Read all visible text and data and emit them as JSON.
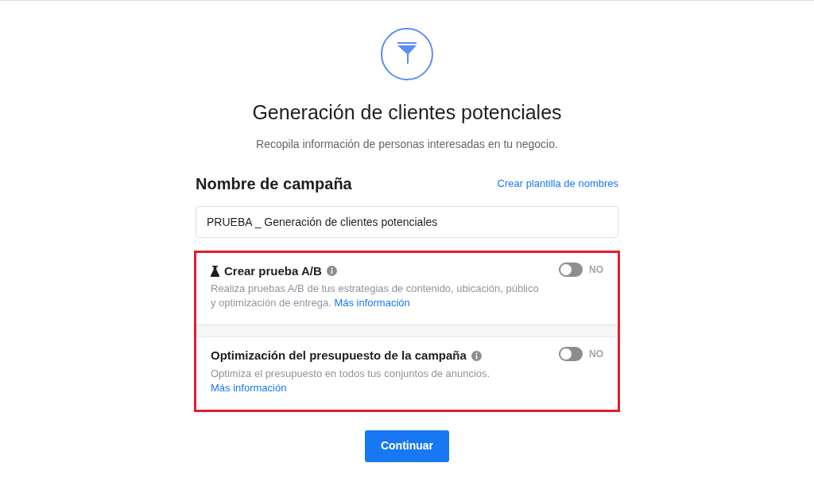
{
  "header": {
    "title": "Generación de clientes potenciales",
    "subtitle": "Recopila información de personas interesadas en tu negocio."
  },
  "campaign_name": {
    "label": "Nombre de campaña",
    "template_link": "Crear plantilla de nombres",
    "value": "PRUEBA _ Generación de clientes potenciales"
  },
  "options": [
    {
      "kind": "ab_test",
      "title": "Crear prueba A/B",
      "description": "Realiza pruebas A/B de tus estrategias de contenido, ubicación, público y optimización de entrega.",
      "link": "Más información",
      "on": false,
      "toggle_label": "NO"
    },
    {
      "kind": "budget",
      "title": "Optimización del presupuesto de la campaña",
      "description": "Optimiza el presupuesto en todos tus conjuntos de anuncios.",
      "link": "Más información",
      "on": false,
      "toggle_label": "NO"
    }
  ],
  "continue_button": "Continuar"
}
